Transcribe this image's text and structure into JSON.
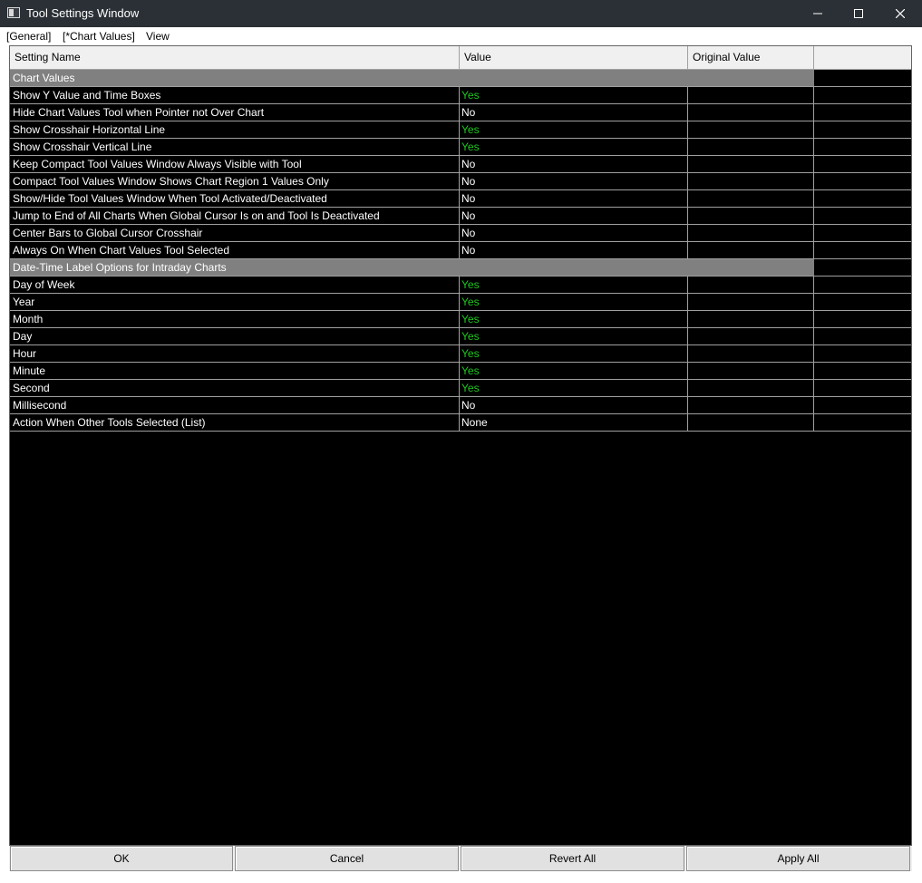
{
  "window": {
    "title": "Tool Settings Window",
    "controls": {
      "minimize": "minimize-icon",
      "maximize": "maximize-icon",
      "close": "close-icon"
    }
  },
  "menu": {
    "items": [
      "[General]",
      "[*Chart Values]",
      "View"
    ]
  },
  "grid": {
    "headers": [
      "Setting Name",
      "Value",
      "Original Value",
      ""
    ],
    "yes_color": "#1ec81e",
    "section_color": "#808080",
    "rows": [
      {
        "type": "section",
        "name": "Chart Values"
      },
      {
        "type": "setting",
        "name": "Show Y Value and Time Boxes",
        "value": "Yes",
        "original": ""
      },
      {
        "type": "setting",
        "name": "Hide Chart Values Tool when Pointer not Over Chart",
        "value": "No",
        "original": ""
      },
      {
        "type": "setting",
        "name": "Show Crosshair Horizontal Line",
        "value": "Yes",
        "original": ""
      },
      {
        "type": "setting",
        "name": "Show Crosshair Vertical Line",
        "value": "Yes",
        "original": ""
      },
      {
        "type": "setting",
        "name": "Keep Compact Tool Values Window Always Visible with Tool",
        "value": "No",
        "original": ""
      },
      {
        "type": "setting",
        "name": "Compact Tool Values Window Shows Chart Region 1 Values Only",
        "value": "No",
        "original": ""
      },
      {
        "type": "setting",
        "name": "Show/Hide Tool Values Window When Tool Activated/Deactivated",
        "value": "No",
        "original": ""
      },
      {
        "type": "setting",
        "name": "Jump to End of All Charts When Global Cursor Is on and Tool Is Deactivated",
        "value": "No",
        "original": ""
      },
      {
        "type": "setting",
        "name": "Center Bars to Global Cursor Crosshair",
        "value": "No",
        "original": ""
      },
      {
        "type": "setting",
        "name": "Always On When Chart Values Tool Selected",
        "value": "No",
        "original": ""
      },
      {
        "type": "section",
        "name": "Date-Time Label Options for Intraday Charts"
      },
      {
        "type": "setting",
        "name": "Day of Week",
        "value": "Yes",
        "original": ""
      },
      {
        "type": "setting",
        "name": "Year",
        "value": "Yes",
        "original": ""
      },
      {
        "type": "setting",
        "name": "Month",
        "value": "Yes",
        "original": ""
      },
      {
        "type": "setting",
        "name": "Day",
        "value": "Yes",
        "original": ""
      },
      {
        "type": "setting",
        "name": "Hour",
        "value": "Yes",
        "original": ""
      },
      {
        "type": "setting",
        "name": "Minute",
        "value": "Yes",
        "original": ""
      },
      {
        "type": "setting",
        "name": "Second",
        "value": "Yes",
        "original": ""
      },
      {
        "type": "setting",
        "name": "Millisecond",
        "value": "No",
        "original": ""
      },
      {
        "type": "setting",
        "name": "Action When Other Tools Selected (List)",
        "value": "None",
        "original": ""
      }
    ]
  },
  "buttons": {
    "ok": "OK",
    "cancel": "Cancel",
    "revert_all": "Revert All",
    "apply_all": "Apply All"
  }
}
